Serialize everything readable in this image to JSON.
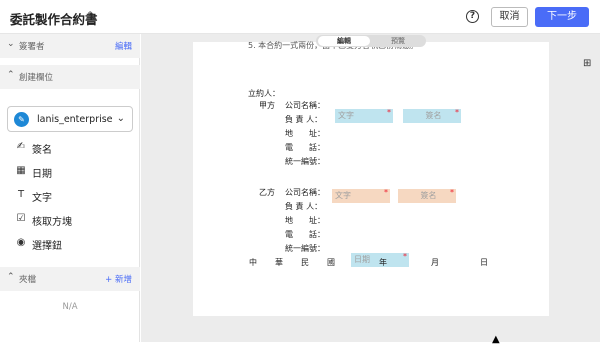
{
  "header": {
    "title": "委託製作合約書",
    "help_icon": "?",
    "cancel_label": "取消",
    "next_label": "下一步"
  },
  "sidebar": {
    "signers_section": {
      "label": "簽署者",
      "action": "編輯"
    },
    "fields_section": {
      "label": "創建欄位"
    },
    "account": {
      "name": "lanis_enterprise",
      "icon": "feather-icon"
    },
    "fields": [
      {
        "label": "簽名",
        "icon": "pen-icon"
      },
      {
        "label": "日期",
        "icon": "calendar-icon"
      },
      {
        "label": "文字",
        "icon": "text-icon"
      },
      {
        "label": "核取方塊",
        "icon": "checkbox-icon"
      },
      {
        "label": "選擇鈕",
        "icon": "radio-icon"
      }
    ],
    "attachments_section": {
      "label": "夾檔",
      "action": "+ 新增"
    },
    "attachments_empty": "N/A"
  },
  "view_toggle": {
    "edit_label": "編輯",
    "preview_label": "預覽"
  },
  "document": {
    "top_clip": "5. 本合約一式兩份，由甲乙雙方各執乙份為憑。",
    "signatory_heading": "立約人：",
    "party_a": "甲方",
    "party_b": "乙方",
    "company_label": "公司名稱：",
    "person_label": "負 責 人：",
    "address_label": "地　　址：",
    "phone_label": "電　　話：",
    "tax_label": "統一編號：",
    "date_line": [
      "中",
      "華",
      "民",
      "國",
      "年",
      "月",
      "日"
    ],
    "placeholders": {
      "text": "文字",
      "signature": "簽名",
      "date": "日期"
    }
  },
  "colors": {
    "accent": "#4a6cf7",
    "party_a_field": "#bfe4ef",
    "party_b_field": "#f6d8c1",
    "required_marker": "#ee2233"
  }
}
